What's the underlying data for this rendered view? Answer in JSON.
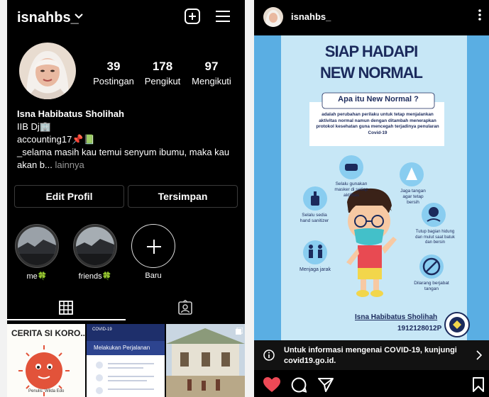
{
  "profile": {
    "username": "isnahbs_",
    "stats": [
      {
        "value": "39",
        "label": "Postingan"
      },
      {
        "value": "178",
        "label": "Pengikut"
      },
      {
        "value": "97",
        "label": "Mengikuti"
      }
    ],
    "name": "Isna Habibatus Sholihah",
    "bio_line1": "IIB Dj🏢",
    "bio_line2": "accounting17📌📗",
    "bio_line3": "_selama masih kau temui senyum ibumu, maka kau akan b...",
    "bio_more": " lainnya",
    "edit_button": "Edit Profil",
    "saved_button": "Tersimpan",
    "highlights": [
      {
        "label": "me🍀"
      },
      {
        "label": "friends🍀"
      },
      {
        "label": "Baru"
      }
    ],
    "grid_post1_title": "CERITA SI KORO...",
    "grid_post1_caption": "Penulis: Wilda Edo",
    "grid_post2_title": "COVID-19",
    "grid_post2_subtitle": "Melakukan Perjalanan"
  },
  "post": {
    "username": "isnahbs_",
    "poster": {
      "title_line1": "SIAP HADAPI",
      "title_line2": "NEW NORMAL",
      "question": "Apa itu New Normal ?",
      "definition": "adalah perubahan perilaku untuk tetap menjalankan aktivitas normal namun dengan ditambah menerapkan protokol kesehatan guna mencegah terjadinya penularan Covid-19",
      "tip1": "Selalu gunakan masker di setiap aktifitas",
      "tip2": "Jaga tangan agar tetap bersih",
      "tip3": "Selalu sedia hand sanitizer",
      "tip4": "Tutup bagian hidung dan mulut saat batuk dan bersin",
      "tip5": "Menjaga jarak",
      "tip6": "Dilarang berjabat tangan",
      "author": "Isna Habibatus Sholihah",
      "author_id": "1912128012P"
    },
    "info_text": "Untuk informasi mengenai COVID-19, kunjungi covid19.go.id."
  },
  "colors": {
    "heart": "#ed4956",
    "poster_bg": "#5aaee3",
    "poster_dark": "#1b2a5c"
  }
}
